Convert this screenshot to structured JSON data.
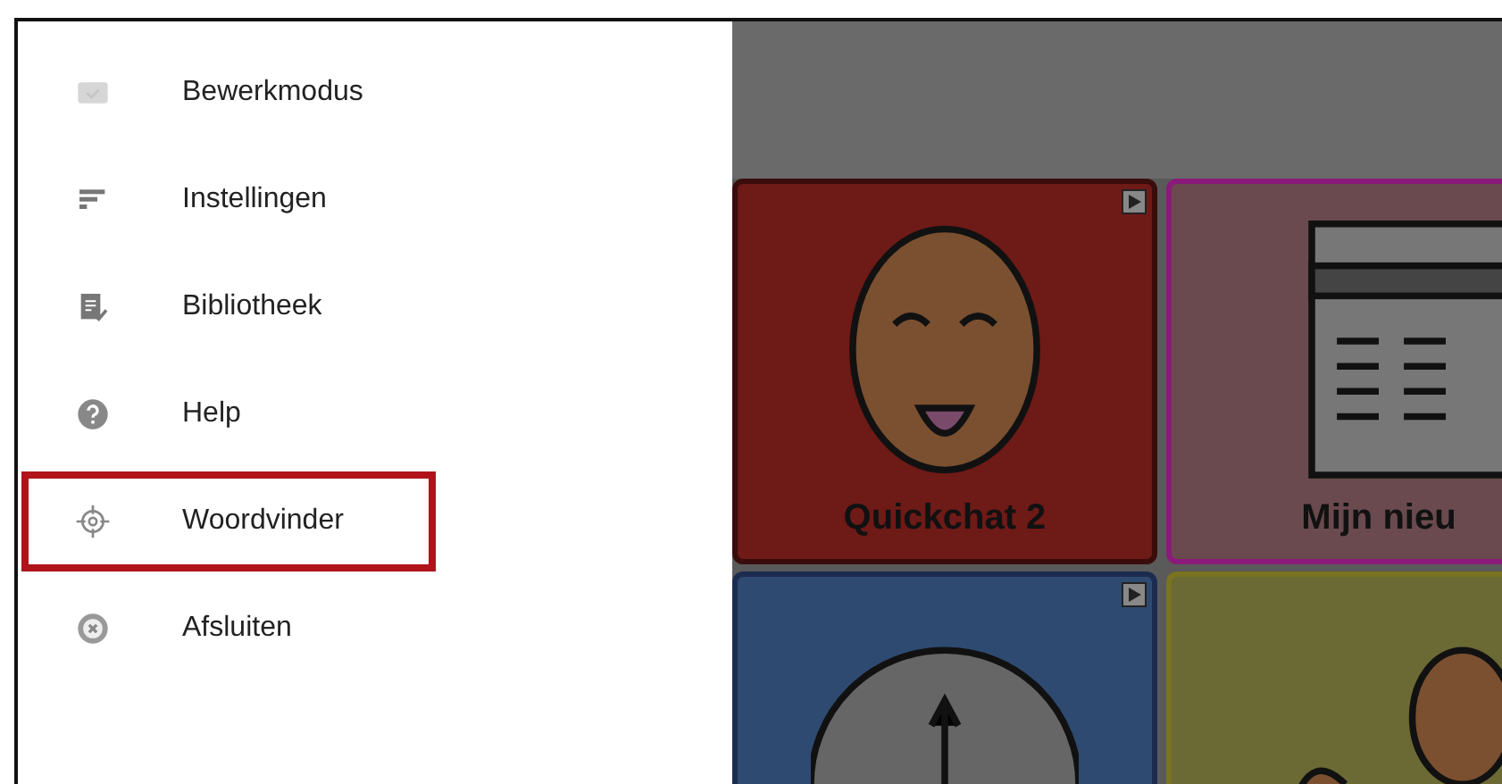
{
  "menu": {
    "items": [
      {
        "label": "Bewerkmodus",
        "highlighted": false
      },
      {
        "label": "Instellingen",
        "highlighted": false
      },
      {
        "label": "Bibliotheek",
        "highlighted": false
      },
      {
        "label": "Help",
        "highlighted": false
      },
      {
        "label": "Woordvinder",
        "highlighted": true
      },
      {
        "label": "Afsluiten",
        "highlighted": false
      }
    ]
  },
  "tiles": [
    {
      "label": "Quickchat 2",
      "color": "#6e1a17",
      "linked": true
    },
    {
      "label": "Mijn nieu",
      "color": "#6a4a4e",
      "linked": false
    },
    {
      "color": "#2e4a70",
      "linked": true
    },
    {
      "color": "#6b6a35",
      "linked": false
    }
  ]
}
